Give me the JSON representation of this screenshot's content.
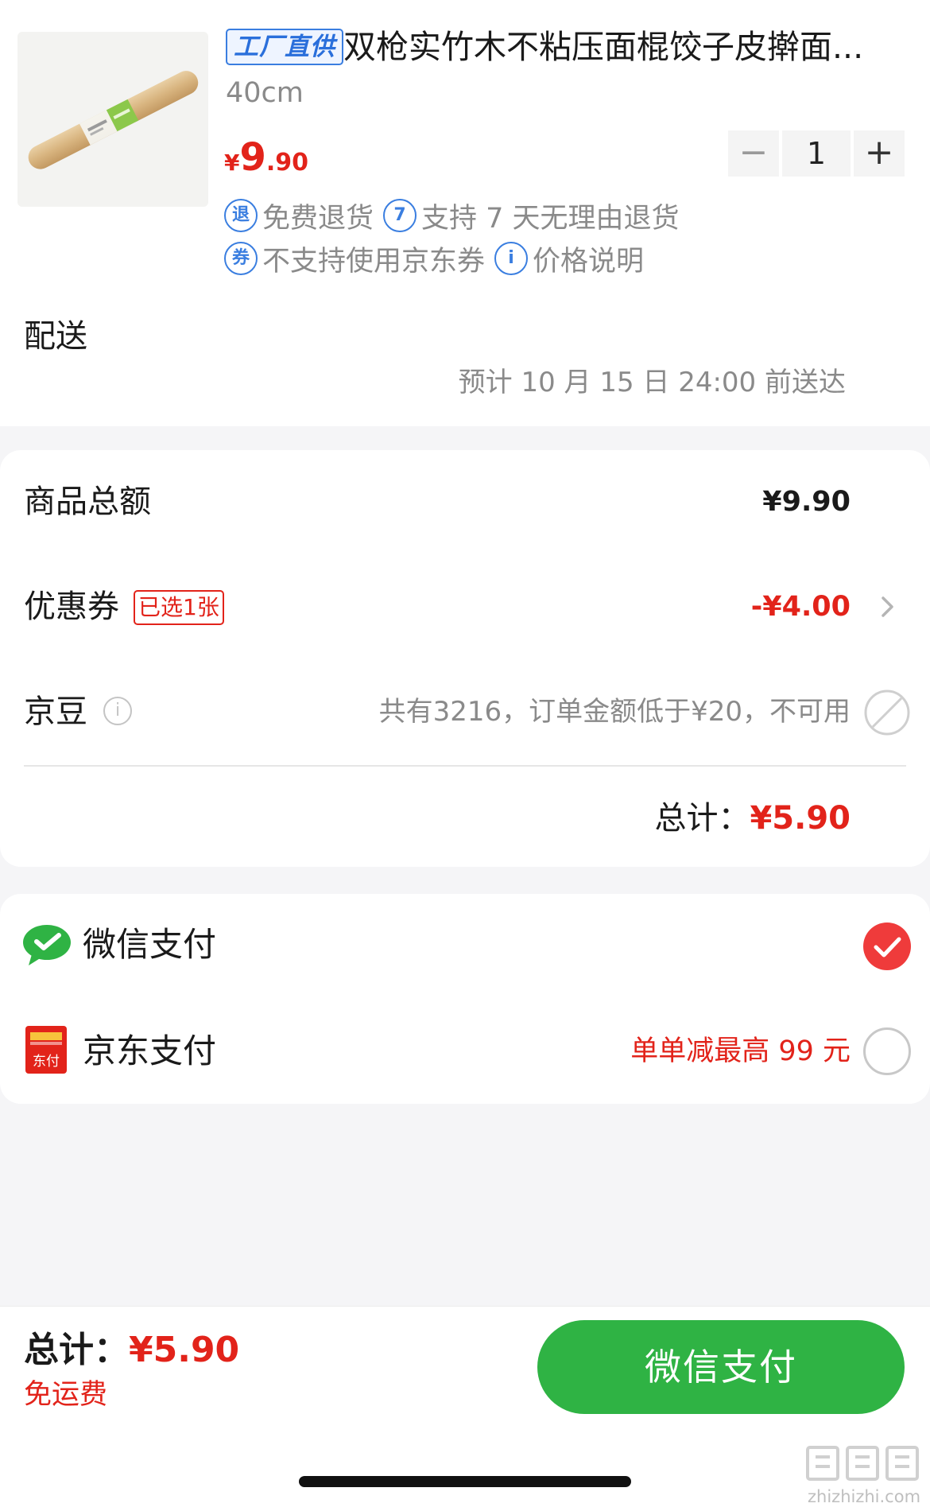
{
  "product": {
    "badge": "工厂直供",
    "title": "双枪实竹木不粘压面棍饺子皮擀面...",
    "spec": "40cm",
    "price_symbol": "¥",
    "price_int": "9",
    "price_dec": ".90",
    "quantity": "1",
    "qty_minus": "−",
    "qty_plus": "+",
    "services": [
      {
        "icon": "退",
        "text": "免费退货"
      },
      {
        "icon": "7",
        "text": "支持 7 天无理由退货"
      },
      {
        "icon": "券",
        "text": "不支持使用京东券"
      },
      {
        "icon": "i",
        "text": "价格说明"
      }
    ]
  },
  "delivery": {
    "label": "配送",
    "eta": "预计 10 月 15 日 24:00 前送达"
  },
  "summary": {
    "goods_total_label": "商品总额",
    "goods_total_value": "¥9.90",
    "coupon_label": "优惠券",
    "coupon_tag": "已选1张",
    "coupon_value": "-¥4.00",
    "jingdou_label": "京豆",
    "jingdou_value": "共有3216，订单金额低于¥20，不可用",
    "total_label": "总计：",
    "total_value": "¥5.90"
  },
  "payment": {
    "wechat_label": "微信支付",
    "jd_label": "京东支付",
    "jd_icon_text": "东付",
    "jd_promo": "单单减最高 99 元",
    "selected": "wechat"
  },
  "bottom": {
    "total_label": "总计：",
    "total_value": "¥5.90",
    "free_shipping": "免运费",
    "pay_button": "微信支付"
  },
  "watermark": {
    "text": "zhizhizhi.com"
  },
  "colors": {
    "accent_red": "#e2231a",
    "wechat_green": "#2fb344",
    "badge_blue": "#3a7ee0"
  }
}
